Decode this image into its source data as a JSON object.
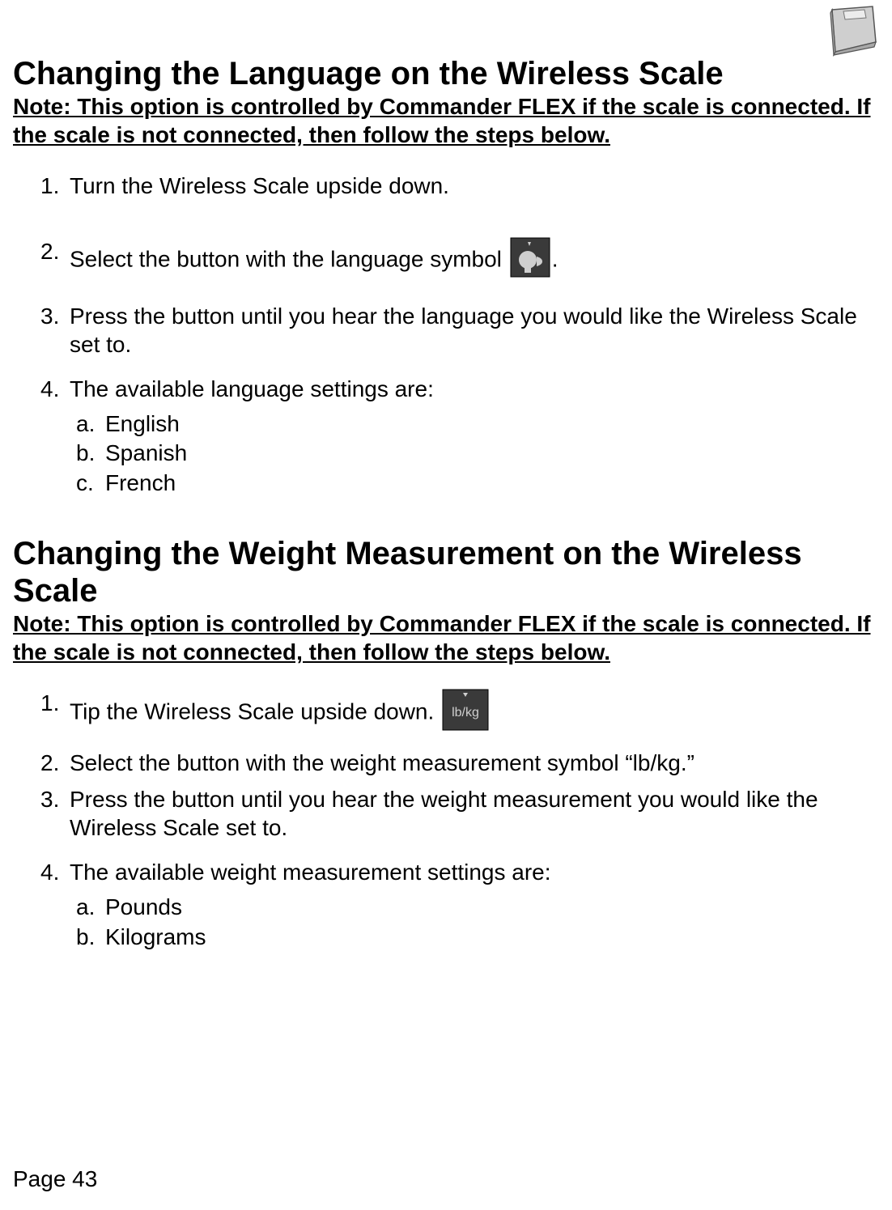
{
  "sectionA": {
    "title": "Changing the Language on the Wireless Scale",
    "note": "Note: This option is controlled by Commander FLEX if the scale is connected.  If the scale is not connected, then follow the steps below.",
    "steps": {
      "s1": "Turn the Wireless Scale upside down.",
      "s2_pre": "Select the button with the language symbol ",
      "s2_post": ".",
      "s3": "Press the button until you hear the language you would like the Wireless Scale set to.",
      "s4": "The available language settings are:",
      "s4a": "English",
      "s4b": "Spanish",
      "s4c": "French"
    }
  },
  "sectionB": {
    "title": "Changing the Weight Measurement on the Wireless Scale",
    "note": "Note: This option is controlled by Commander FLEX if the scale is connected.  If the scale is not connected, then follow the steps below.",
    "steps": {
      "s1_pre": "Tip the Wireless Scale upside down. ",
      "s2": "Select the button with the weight measurement symbol  “lb/kg.”",
      "s3": "Press the button until you hear the weight measurement you would like the Wireless Scale set to.",
      "s4": "The available weight measurement settings are:",
      "s4a": "Pounds",
      "s4b": "Kilograms"
    }
  },
  "nums": {
    "n1": "1.",
    "n2": "2.",
    "n3": "3.",
    "n4": "4."
  },
  "letters": {
    "a": "a.",
    "b": "b.",
    "c": "c."
  },
  "icons": {
    "lbkg_text": "lb/kg"
  },
  "pageNumber": "Page 43"
}
